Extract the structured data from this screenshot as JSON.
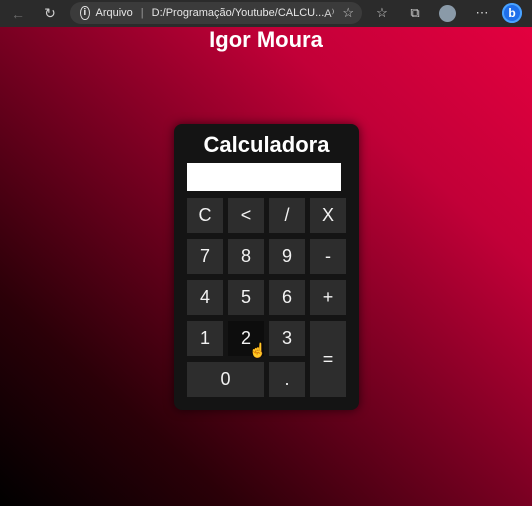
{
  "browser": {
    "protocol_label": "Arquivo",
    "url": "D:/Programação/Youtube/CALCU...",
    "read_aloud_label": "A⁾"
  },
  "page": {
    "author": "Igor Moura"
  },
  "calculator": {
    "title": "Calculadora",
    "display_value": "",
    "keys": {
      "clear": "C",
      "back": "<",
      "divide": "/",
      "multiply": "X",
      "seven": "7",
      "eight": "8",
      "nine": "9",
      "minus": "-",
      "four": "4",
      "five": "5",
      "six": "6",
      "plus": "+",
      "one": "1",
      "two": "2",
      "three": "3",
      "equals": "=",
      "zero": "0",
      "dot": "."
    }
  },
  "colors": {
    "gradient_top": "#e3003f",
    "gradient_bottom": "#000000",
    "panel": "#141414",
    "key": "#2d2d2d"
  },
  "icons": [
    "back-arrow-icon",
    "refresh-icon",
    "info-icon",
    "read-aloud-icon",
    "add-favorite-icon",
    "favorites-icon",
    "collections-icon",
    "profile-avatar-icon",
    "more-icon",
    "bing-icon",
    "pointer-cursor-icon"
  ]
}
